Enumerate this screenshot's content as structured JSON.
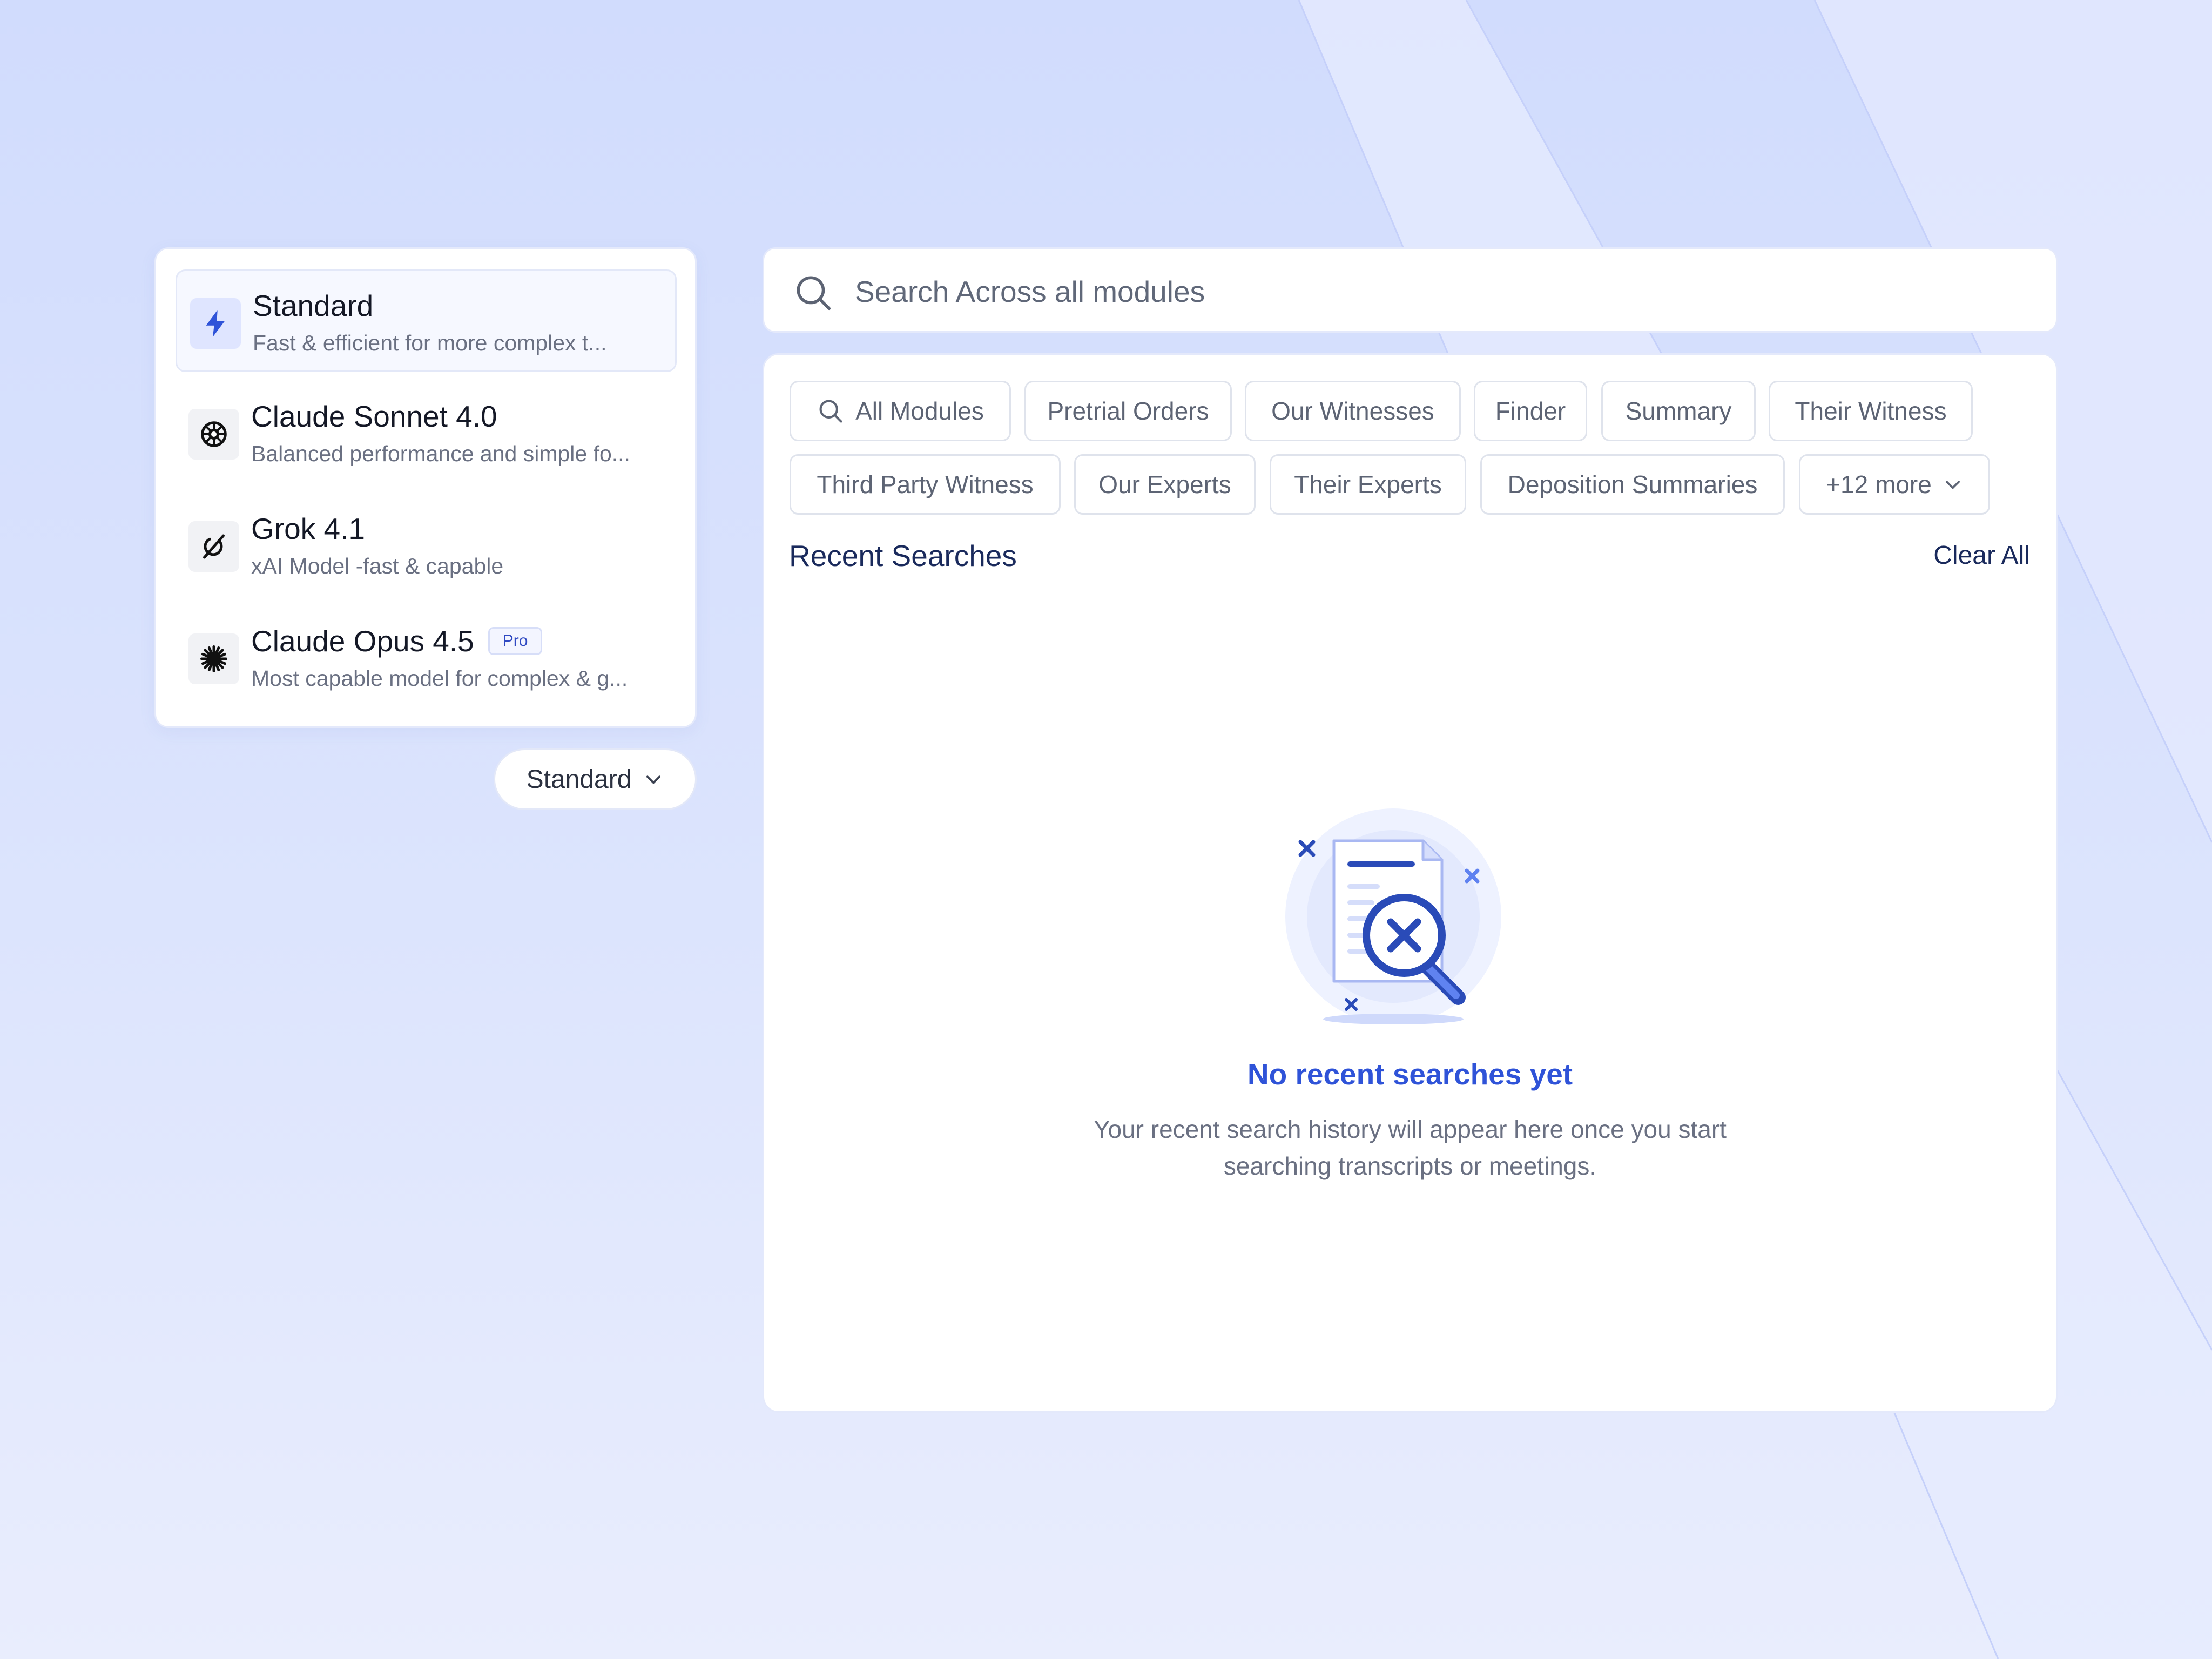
{
  "model_selector": {
    "items": [
      {
        "name": "Standard",
        "description": "Fast & efficient for more complex t...",
        "icon": "lightning-bolt-icon",
        "selected": true
      },
      {
        "name": "Claude Sonnet 4.0",
        "description": "Balanced performance and simple fo...",
        "icon": "sonnet-logo-icon"
      },
      {
        "name": "Grok 4.1",
        "description": "xAI Model -fast & capable",
        "icon": "grok-logo-icon"
      },
      {
        "name": "Claude Opus 4.5",
        "description": "Most capable model for complex & g...",
        "icon": "claude-sparkle-icon",
        "badge": "Pro"
      }
    ],
    "dropdown_label": "Standard"
  },
  "search": {
    "placeholder": "Search Across all modules"
  },
  "filters": {
    "chips": [
      "All Modules",
      "Pretrial Orders",
      "Our Witnesses",
      "Finder",
      "Summary",
      "Their Witness",
      "Third Party Witness",
      "Our Experts",
      "Their Experts",
      "Deposition Summaries"
    ],
    "more_label": "+12 more"
  },
  "recent": {
    "title": "Recent Searches",
    "clear_label": "Clear All",
    "empty_title": "No recent searches yet",
    "empty_description": "Your recent search history will appear here once you start searching transcripts or meetings."
  },
  "colors": {
    "accent": "#2f53d8",
    "heading": "#1a2a5c",
    "background": "#d1dcfd"
  }
}
